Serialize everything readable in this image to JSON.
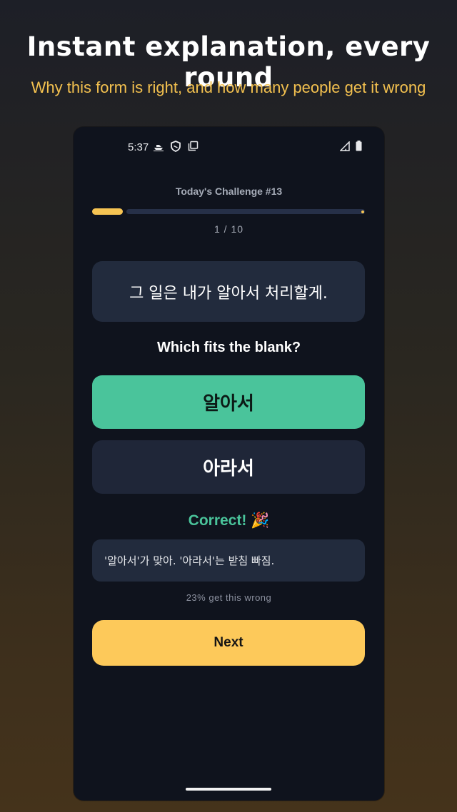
{
  "promo": {
    "title": "Instant explanation, every round",
    "subtitle": "Why this form is right, and how many people get it wrong"
  },
  "status_bar": {
    "time": "5:37",
    "icons": [
      "boat-icon",
      "shield-icon",
      "copy-icon",
      "signal-icon",
      "battery-icon"
    ]
  },
  "quiz": {
    "challenge_title": "Today's Challenge #13",
    "progress_text": "1 / 10",
    "progress_fraction": 0.1,
    "sentence": "그 일은 내가 알아서 처리할게.",
    "prompt": "Which fits the blank?",
    "options": [
      {
        "label": "알아서",
        "state": "correct"
      },
      {
        "label": "아라서",
        "state": "default"
      }
    ],
    "feedback": "Correct! 🎉",
    "explanation": "'알아서'가 맞아. '아라서'는 받침 빠짐.",
    "stat": "23% get this wrong",
    "next_label": "Next"
  },
  "colors": {
    "accent_yellow": "#fdc95a",
    "correct_green": "#4ac49b",
    "card_bg": "#222b3d",
    "screen_bg": "#0f131d"
  }
}
